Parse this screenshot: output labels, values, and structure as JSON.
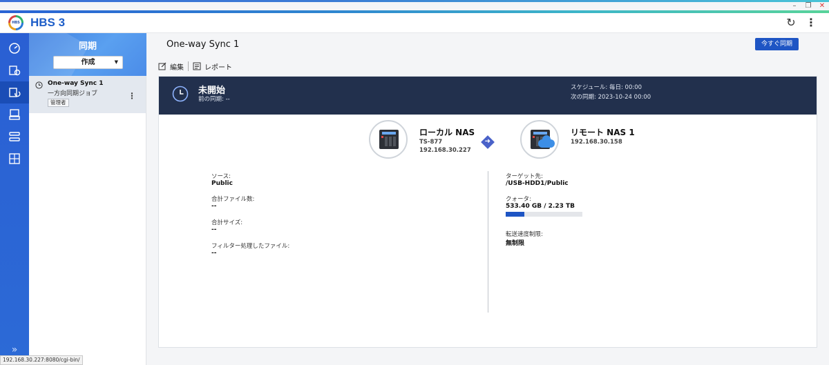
{
  "app": {
    "title": "HBS 3"
  },
  "list_panel": {
    "header_title": "同期",
    "create_button": "作成",
    "job": {
      "name": "One-way Sync 1",
      "type": "一方向同期ジョブ",
      "badge": "管理者"
    }
  },
  "main": {
    "title": "One-way Sync 1",
    "sync_now": "今すぐ同期",
    "toolbar": {
      "edit": "編集",
      "report": "レポート"
    },
    "status": {
      "label": "未開始",
      "last_sync": "前の同期: --",
      "schedule": "スケジュール: 毎日: 00:00",
      "next_sync": "次の同期: 2023-10-24 00:00"
    },
    "local": {
      "name": "ローカル NAS",
      "model": "TS-877",
      "ip": "192.168.30.227"
    },
    "remote": {
      "name": "リモート NAS 1",
      "ip": "192.168.30.158"
    },
    "source": {
      "label": "ソース:",
      "value": "Public",
      "total_files_label": "合計ファイル数:",
      "total_files": "--",
      "total_size_label": "合計サイズ:",
      "total_size": "--",
      "filtered_label": "フィルター処理したファイル:",
      "filtered": "--"
    },
    "target": {
      "label": "ターゲット先:",
      "value": "/USB-HDD1/Public",
      "quota_label": "クォータ:",
      "quota": "533.40 GB / 2.23 TB",
      "quota_fraction": 0.239,
      "speed_label": "転送速度制限:",
      "speed": "無制限"
    }
  },
  "status_url": "192.168.30.227:8080/cgi-bin/",
  "colors": {
    "accent": "#1e55c4",
    "status_bar": "#22304d",
    "rail": "#2a5fd3"
  }
}
